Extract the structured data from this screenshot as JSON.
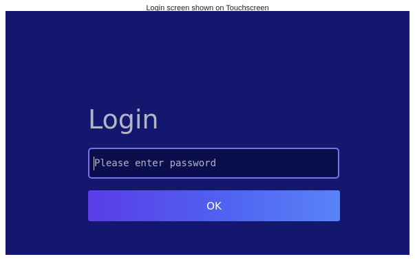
{
  "top_bar": {
    "text": "Login screen shown on Touchscreen"
  },
  "login": {
    "title": "Login",
    "password_placeholder": "Please enter password",
    "password_value": "",
    "ok_label": "OK"
  },
  "colors": {
    "panel_background": "#14176e",
    "input_background": "#0b0e4c",
    "input_border": "#7775e6",
    "button_gradient_start": "#5a3de8",
    "button_gradient_end": "#5a83f8"
  }
}
